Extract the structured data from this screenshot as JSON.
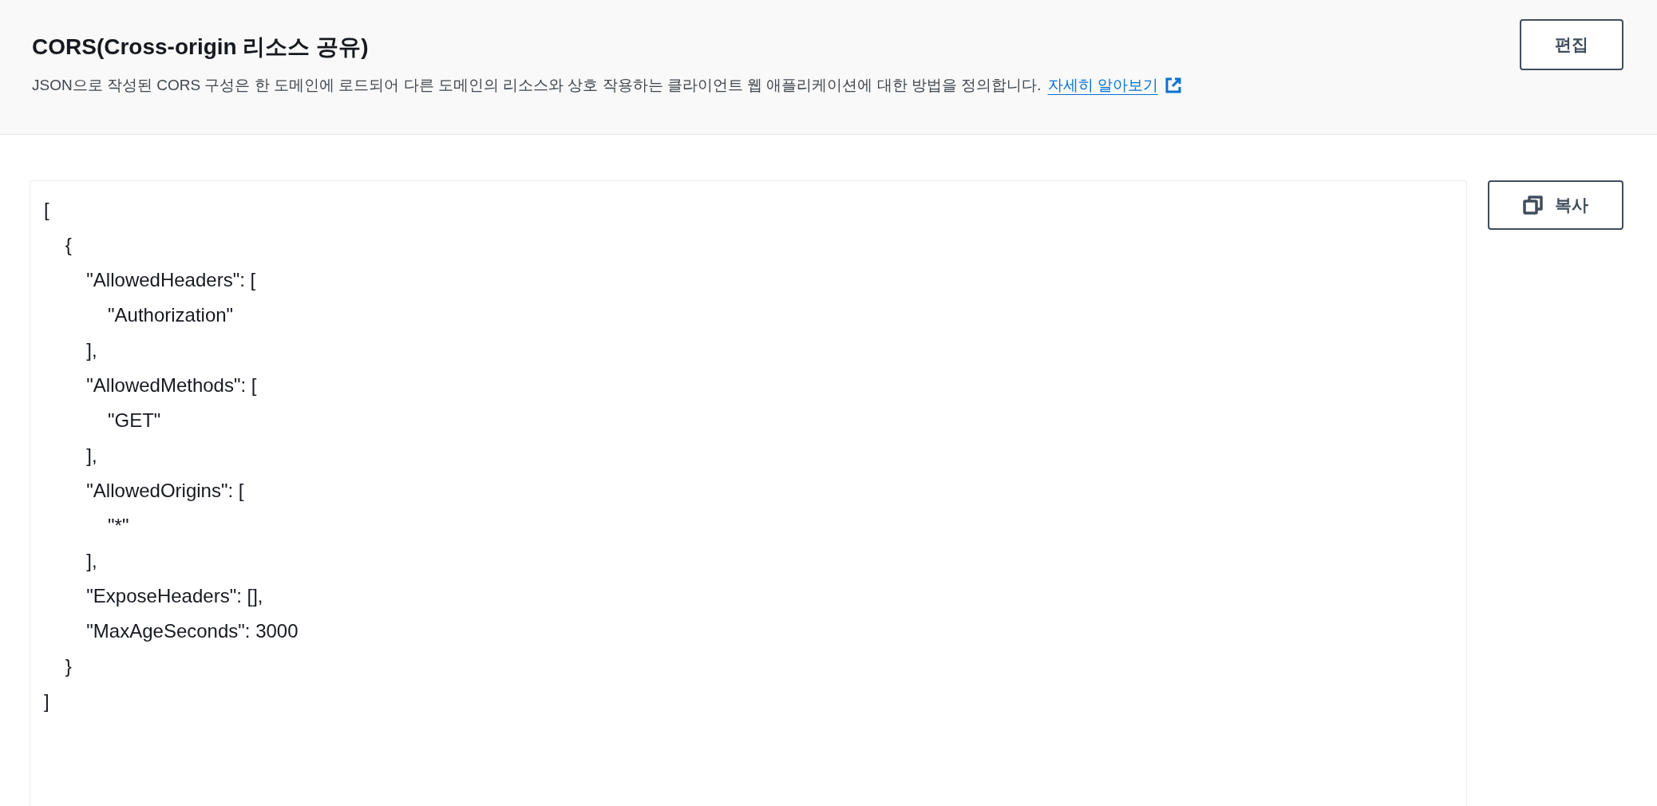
{
  "header": {
    "title": "CORS(Cross-origin 리소스 공유)",
    "description": "JSON으로 작성된 CORS 구성은 한 도메인에 로드되어 다른 도메인의 리소스와 상호 작용하는 클라이언트 웹 애플리케이션에 대한 방법을 정의합니다.",
    "link": "자세히 알아보기",
    "edit_button": "편집"
  },
  "code": "[\n    {\n        \"AllowedHeaders\": [\n            \"Authorization\"\n        ],\n        \"AllowedMethods\": [\n            \"GET\"\n        ],\n        \"AllowedOrigins\": [\n            \"*\"\n        ],\n        \"ExposeHeaders\": [],\n        \"MaxAgeSeconds\": 3000\n    }\n]",
  "copy_button": "복사"
}
